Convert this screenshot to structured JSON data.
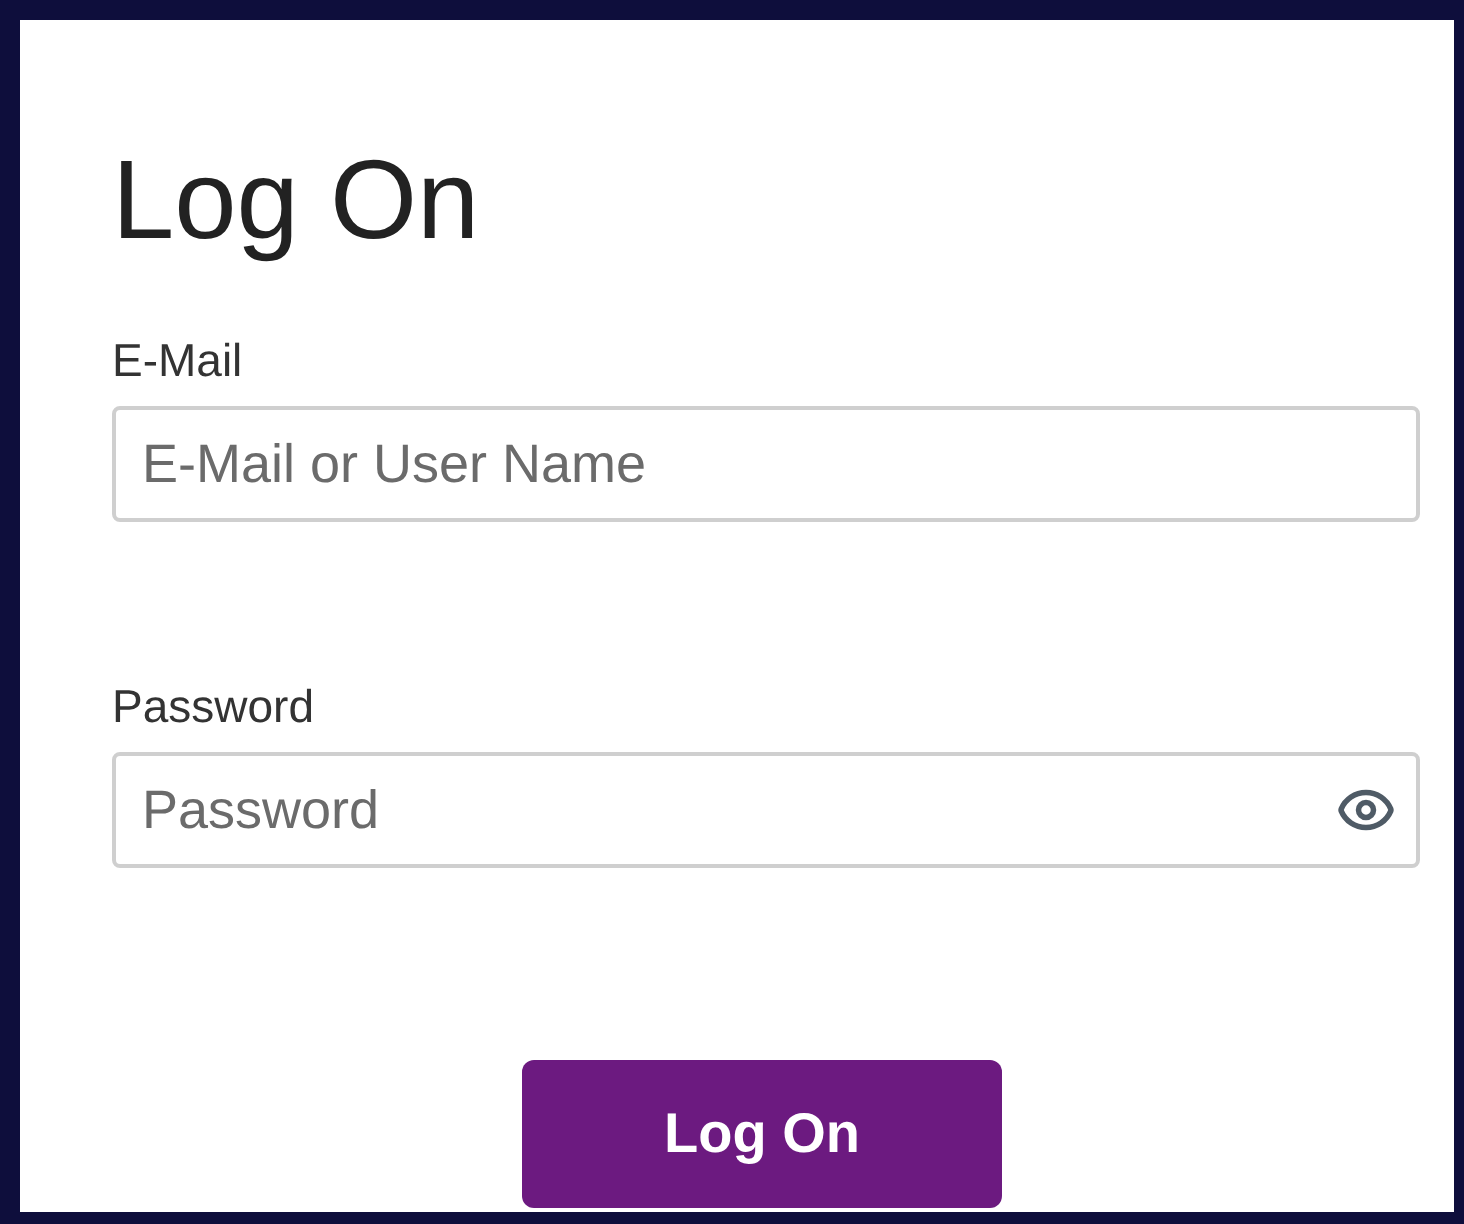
{
  "title": "Log On",
  "fields": [
    {
      "label": "E-Mail",
      "placeholder": "E-Mail or User Name",
      "kind": "text"
    },
    {
      "label": "Password",
      "placeholder": "Password",
      "kind": "password"
    }
  ],
  "button": "Log On"
}
